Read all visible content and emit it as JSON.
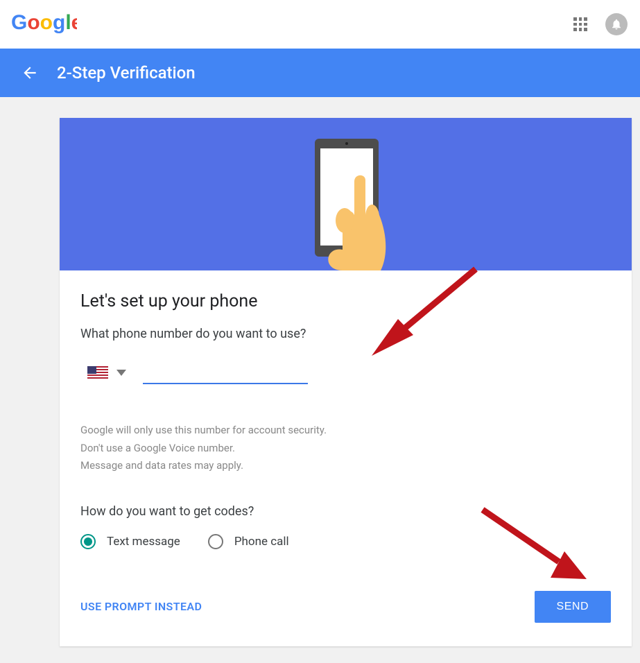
{
  "header": {
    "title": "2-Step Verification"
  },
  "main": {
    "heading": "Let's set up your phone",
    "phone_question": "What phone number do you want to use?",
    "phone_value": "",
    "country": "US",
    "note1": "Google will only use this number for account security.",
    "note2": "Don't use a Google Voice number.",
    "note3": "Message and data rates may apply.",
    "code_question": "How do you want to get codes?",
    "radio_text": "Text message",
    "radio_call": "Phone call",
    "selected_radio": "text",
    "prompt_link": "USE PROMPT INSTEAD",
    "send_label": "SEND"
  },
  "icons": {
    "apps": "apps-icon",
    "bell": "bell-icon",
    "back": "back-arrow-icon",
    "dropdown": "chevron-down-icon",
    "flag_us": "us-flag-icon"
  },
  "logo": {
    "g1": "G",
    "o1": "o",
    "o2": "o",
    "g2": "g",
    "l": "l",
    "e": "e"
  }
}
